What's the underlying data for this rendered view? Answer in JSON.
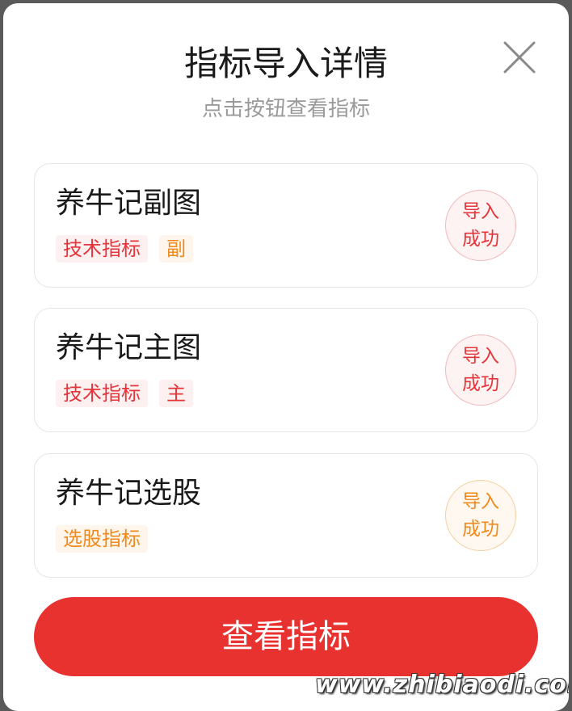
{
  "dialog": {
    "title": "指标导入详情",
    "subtitle": "点击按钮查看指标",
    "close_icon": "close-icon"
  },
  "indicators": [
    {
      "name": "养牛记副图",
      "tags": [
        {
          "label": "技术指标",
          "color": "#e5353a"
        },
        {
          "label": "副",
          "color": "#f08a1c"
        }
      ],
      "status": {
        "line1": "导入",
        "line2": "成功",
        "color": "#e5353a"
      }
    },
    {
      "name": "养牛记主图",
      "tags": [
        {
          "label": "技术指标",
          "color": "#e5353a"
        },
        {
          "label": "主",
          "color": "#e5353a"
        }
      ],
      "status": {
        "line1": "导入",
        "line2": "成功",
        "color": "#e5353a"
      }
    },
    {
      "name": "养牛记选股",
      "tags": [
        {
          "label": "选股指标",
          "color": "#f08a1c"
        }
      ],
      "status": {
        "line1": "导入",
        "line2": "成功",
        "color": "#f08a1c"
      }
    }
  ],
  "actions": {
    "view_label": "查看指标",
    "view_color": "#e8322f"
  },
  "watermark": "www.zhibiaodi.com"
}
